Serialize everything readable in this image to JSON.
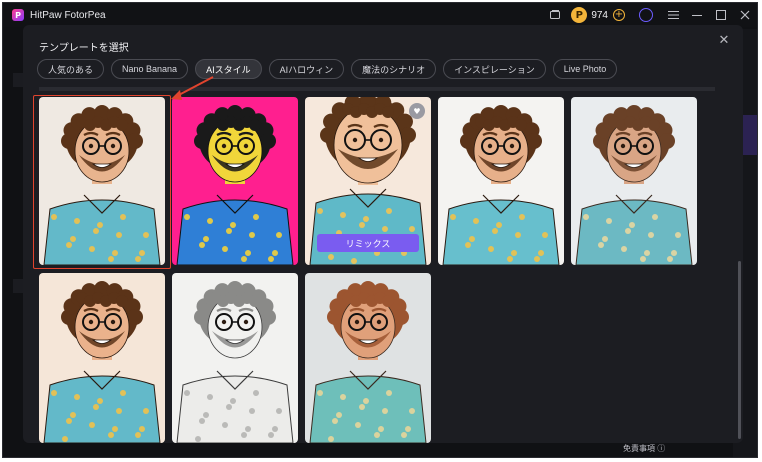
{
  "window": {
    "app_title": "HitPaw FotorPea",
    "coins": "974"
  },
  "modal": {
    "title": "テンプレートを選択",
    "tabs": [
      {
        "label": "人気のある",
        "active": false
      },
      {
        "label": "Nano Banana",
        "active": false
      },
      {
        "label": "AIスタイル",
        "active": true
      },
      {
        "label": "AIハロウィン",
        "active": false
      },
      {
        "label": "魔法のシナリオ",
        "active": false
      },
      {
        "label": "インスピレーション",
        "active": false
      },
      {
        "label": "Live Photo",
        "active": false
      }
    ],
    "remix_label": "リミックス",
    "templates": [
      {
        "style": "cartoon-warm",
        "selected": true
      },
      {
        "style": "pop-art-pink",
        "selected": false
      },
      {
        "style": "big-head-cartoon",
        "selected": false,
        "hovered": true
      },
      {
        "style": "cartoon-white",
        "selected": false
      },
      {
        "style": "realistic-studio",
        "selected": false
      },
      {
        "style": "cartoon-cream",
        "selected": false
      },
      {
        "style": "pencil-sketch",
        "selected": false
      },
      {
        "style": "clay-figure",
        "selected": false
      }
    ]
  },
  "background": {
    "disclaimer": "免責事項 ⓘ"
  },
  "colors": {
    "accent": "#7a5cf0",
    "selection": "#e0442e",
    "coin": "#f3b43a"
  }
}
